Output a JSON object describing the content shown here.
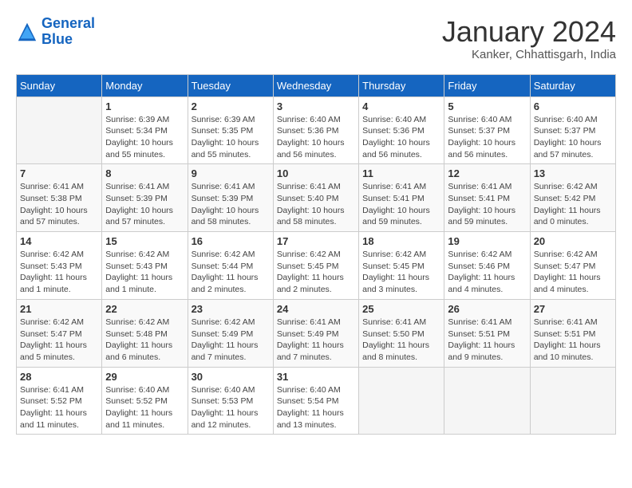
{
  "header": {
    "logo_line1": "General",
    "logo_line2": "Blue",
    "month": "January 2024",
    "location": "Kanker, Chhattisgarh, India"
  },
  "days_of_week": [
    "Sunday",
    "Monday",
    "Tuesday",
    "Wednesday",
    "Thursday",
    "Friday",
    "Saturday"
  ],
  "weeks": [
    [
      {
        "num": "",
        "info": ""
      },
      {
        "num": "1",
        "info": "Sunrise: 6:39 AM\nSunset: 5:34 PM\nDaylight: 10 hours\nand 55 minutes."
      },
      {
        "num": "2",
        "info": "Sunrise: 6:39 AM\nSunset: 5:35 PM\nDaylight: 10 hours\nand 55 minutes."
      },
      {
        "num": "3",
        "info": "Sunrise: 6:40 AM\nSunset: 5:36 PM\nDaylight: 10 hours\nand 56 minutes."
      },
      {
        "num": "4",
        "info": "Sunrise: 6:40 AM\nSunset: 5:36 PM\nDaylight: 10 hours\nand 56 minutes."
      },
      {
        "num": "5",
        "info": "Sunrise: 6:40 AM\nSunset: 5:37 PM\nDaylight: 10 hours\nand 56 minutes."
      },
      {
        "num": "6",
        "info": "Sunrise: 6:40 AM\nSunset: 5:37 PM\nDaylight: 10 hours\nand 57 minutes."
      }
    ],
    [
      {
        "num": "7",
        "info": "Sunrise: 6:41 AM\nSunset: 5:38 PM\nDaylight: 10 hours\nand 57 minutes."
      },
      {
        "num": "8",
        "info": "Sunrise: 6:41 AM\nSunset: 5:39 PM\nDaylight: 10 hours\nand 57 minutes."
      },
      {
        "num": "9",
        "info": "Sunrise: 6:41 AM\nSunset: 5:39 PM\nDaylight: 10 hours\nand 58 minutes."
      },
      {
        "num": "10",
        "info": "Sunrise: 6:41 AM\nSunset: 5:40 PM\nDaylight: 10 hours\nand 58 minutes."
      },
      {
        "num": "11",
        "info": "Sunrise: 6:41 AM\nSunset: 5:41 PM\nDaylight: 10 hours\nand 59 minutes."
      },
      {
        "num": "12",
        "info": "Sunrise: 6:41 AM\nSunset: 5:41 PM\nDaylight: 10 hours\nand 59 minutes."
      },
      {
        "num": "13",
        "info": "Sunrise: 6:42 AM\nSunset: 5:42 PM\nDaylight: 11 hours\nand 0 minutes."
      }
    ],
    [
      {
        "num": "14",
        "info": "Sunrise: 6:42 AM\nSunset: 5:43 PM\nDaylight: 11 hours\nand 1 minute."
      },
      {
        "num": "15",
        "info": "Sunrise: 6:42 AM\nSunset: 5:43 PM\nDaylight: 11 hours\nand 1 minute."
      },
      {
        "num": "16",
        "info": "Sunrise: 6:42 AM\nSunset: 5:44 PM\nDaylight: 11 hours\nand 2 minutes."
      },
      {
        "num": "17",
        "info": "Sunrise: 6:42 AM\nSunset: 5:45 PM\nDaylight: 11 hours\nand 2 minutes."
      },
      {
        "num": "18",
        "info": "Sunrise: 6:42 AM\nSunset: 5:45 PM\nDaylight: 11 hours\nand 3 minutes."
      },
      {
        "num": "19",
        "info": "Sunrise: 6:42 AM\nSunset: 5:46 PM\nDaylight: 11 hours\nand 4 minutes."
      },
      {
        "num": "20",
        "info": "Sunrise: 6:42 AM\nSunset: 5:47 PM\nDaylight: 11 hours\nand 4 minutes."
      }
    ],
    [
      {
        "num": "21",
        "info": "Sunrise: 6:42 AM\nSunset: 5:47 PM\nDaylight: 11 hours\nand 5 minutes."
      },
      {
        "num": "22",
        "info": "Sunrise: 6:42 AM\nSunset: 5:48 PM\nDaylight: 11 hours\nand 6 minutes."
      },
      {
        "num": "23",
        "info": "Sunrise: 6:42 AM\nSunset: 5:49 PM\nDaylight: 11 hours\nand 7 minutes."
      },
      {
        "num": "24",
        "info": "Sunrise: 6:41 AM\nSunset: 5:49 PM\nDaylight: 11 hours\nand 7 minutes."
      },
      {
        "num": "25",
        "info": "Sunrise: 6:41 AM\nSunset: 5:50 PM\nDaylight: 11 hours\nand 8 minutes."
      },
      {
        "num": "26",
        "info": "Sunrise: 6:41 AM\nSunset: 5:51 PM\nDaylight: 11 hours\nand 9 minutes."
      },
      {
        "num": "27",
        "info": "Sunrise: 6:41 AM\nSunset: 5:51 PM\nDaylight: 11 hours\nand 10 minutes."
      }
    ],
    [
      {
        "num": "28",
        "info": "Sunrise: 6:41 AM\nSunset: 5:52 PM\nDaylight: 11 hours\nand 11 minutes."
      },
      {
        "num": "29",
        "info": "Sunrise: 6:40 AM\nSunset: 5:52 PM\nDaylight: 11 hours\nand 11 minutes."
      },
      {
        "num": "30",
        "info": "Sunrise: 6:40 AM\nSunset: 5:53 PM\nDaylight: 11 hours\nand 12 minutes."
      },
      {
        "num": "31",
        "info": "Sunrise: 6:40 AM\nSunset: 5:54 PM\nDaylight: 11 hours\nand 13 minutes."
      },
      {
        "num": "",
        "info": ""
      },
      {
        "num": "",
        "info": ""
      },
      {
        "num": "",
        "info": ""
      }
    ]
  ]
}
